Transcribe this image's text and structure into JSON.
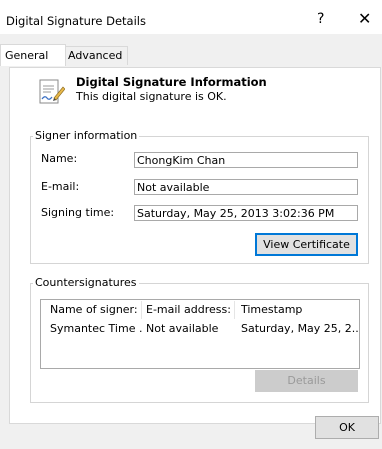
{
  "window": {
    "title": "Digital Signature Details",
    "help_label": "?",
    "close_label": "✕"
  },
  "tabs": [
    {
      "label": "General",
      "active": true
    },
    {
      "label": "Advanced",
      "active": false
    }
  ],
  "header": {
    "title": "Digital Signature Information",
    "status": "This digital signature is OK."
  },
  "signer": {
    "group_label": "Signer information",
    "name_label": "Name:",
    "name_value": "ChongKim Chan",
    "email_label": "E-mail:",
    "email_value": "Not available",
    "time_label": "Signing time:",
    "time_value": "Saturday, May 25, 2013 3:02:36 PM",
    "view_certificate_label": "View Certificate"
  },
  "countersignatures": {
    "group_label": "Countersignatures",
    "columns": [
      "Name of signer:",
      "E-mail address:",
      "Timestamp"
    ],
    "rows": [
      [
        "Symantec Time ...",
        "Not available",
        "Saturday, May 25, 2..."
      ]
    ],
    "details_label": "Details"
  },
  "footer": {
    "ok_label": "OK"
  },
  "colors": {
    "focus_accent": "#0078d7",
    "panel_bg": "#ffffff",
    "dialog_bg": "#f0f0f0"
  }
}
